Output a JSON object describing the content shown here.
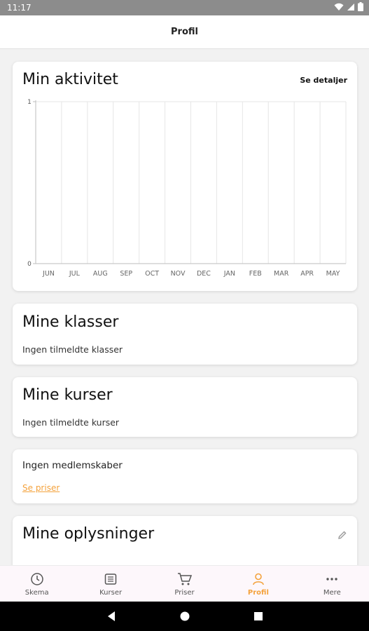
{
  "status_bar": {
    "time": "11:17"
  },
  "header": {
    "title": "Profil"
  },
  "activity": {
    "title": "Min aktivitet",
    "details_link": "Se detaljer"
  },
  "chart_data": {
    "type": "bar",
    "categories": [
      "JUN",
      "JUL",
      "AUG",
      "SEP",
      "OCT",
      "NOV",
      "DEC",
      "JAN",
      "FEB",
      "MAR",
      "APR",
      "MAY"
    ],
    "values": [
      0,
      0,
      0,
      0,
      0,
      0,
      0,
      0,
      0,
      0,
      0,
      0
    ],
    "ylim": [
      0,
      1
    ],
    "yticks": [
      "0",
      "1"
    ],
    "grid": true
  },
  "classes": {
    "title": "Mine klasser",
    "empty": "Ingen tilmeldte klasser"
  },
  "courses": {
    "title": "Mine kurser",
    "empty": "Ingen tilmeldte kurser"
  },
  "membership": {
    "text": "Ingen medlemskaber",
    "link": "Se priser"
  },
  "info": {
    "title": "Mine oplysninger",
    "edit_icon": "pencil-icon"
  },
  "bottom_nav": {
    "items": [
      {
        "label": "Skema",
        "icon": "clock-icon"
      },
      {
        "label": "Kurser",
        "icon": "list-icon"
      },
      {
        "label": "Priser",
        "icon": "cart-icon"
      },
      {
        "label": "Profil",
        "icon": "person-icon"
      },
      {
        "label": "Mere",
        "icon": "more-icon"
      }
    ]
  },
  "colors": {
    "accent": "#f4a23c",
    "text": "#111111",
    "status_bar": "#8c8c8c"
  }
}
